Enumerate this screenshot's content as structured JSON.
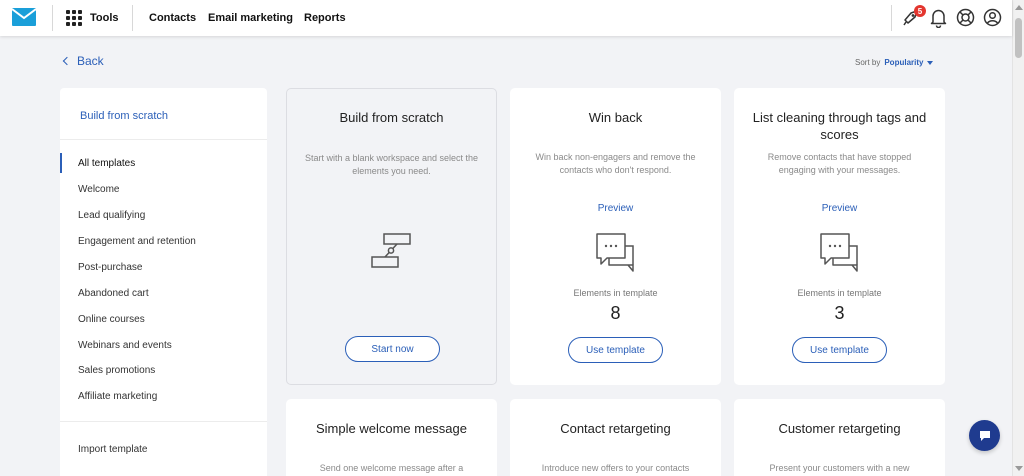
{
  "nav": {
    "tools_label": "Tools",
    "links": [
      "Contacts",
      "Email marketing",
      "Reports"
    ],
    "notification_count": "5"
  },
  "back_label": "Back",
  "sort": {
    "label": "Sort by",
    "value": "Popularity"
  },
  "sidebar": {
    "top_item": "Build from scratch",
    "items": [
      "All templates",
      "Welcome",
      "Lead qualifying",
      "Engagement and retention",
      "Post-purchase",
      "Abandoned cart",
      "Online courses",
      "Webinars and events",
      "Sales promotions",
      "Affiliate marketing"
    ],
    "active_index": 0,
    "import_label": "Import template"
  },
  "cards": [
    {
      "title": "Build from scratch",
      "description": "Start with a blank workspace and select the elements you need.",
      "button": "Start now"
    },
    {
      "title": "Win back",
      "description": "Win back non-engagers and remove the contacts who don't respond.",
      "preview": "Preview",
      "elements_label": "Elements in template",
      "elements_count": "8",
      "button": "Use template"
    },
    {
      "title": "List cleaning through tags and scores",
      "description": "Remove contacts that have stopped engaging with your messages.",
      "preview": "Preview",
      "elements_label": "Elements in template",
      "elements_count": "3",
      "button": "Use template"
    },
    {
      "title": "Simple welcome message",
      "description": "Send one welcome message after a"
    },
    {
      "title": "Contact retargeting",
      "description": "Introduce new offers to your contacts"
    },
    {
      "title": "Customer retargeting",
      "description": "Present your customers with a new"
    }
  ],
  "colors": {
    "accent": "#2b5fb8",
    "badge": "#e3362f",
    "background": "#f2f3f6",
    "logo": "#1a9fd9",
    "fab": "#1f3b8f"
  },
  "icons": {
    "logo": "envelope-logo-icon",
    "tools": "app-grid-icon",
    "rocket": "rocket-icon",
    "bell": "bell-icon",
    "help": "lifebuoy-icon",
    "account": "user-circle-icon",
    "scratch": "workflow-icon",
    "chat": "chat-bubbles-icon"
  }
}
